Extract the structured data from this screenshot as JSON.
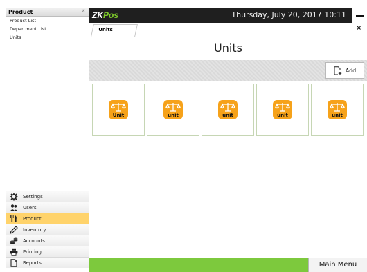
{
  "sidebar": {
    "header": "Product",
    "collapse_glyph": "«",
    "sub_items": [
      "Product List",
      "Department List",
      "Units"
    ],
    "nav_items": [
      {
        "label": "Settings",
        "icon": "gear-icon"
      },
      {
        "label": "Users",
        "icon": "users-icon"
      },
      {
        "label": "Product",
        "icon": "fork-knife-icon",
        "active": true
      },
      {
        "label": "Inventory",
        "icon": "pencil-icon"
      },
      {
        "label": "Accounts",
        "icon": "coins-icon"
      },
      {
        "label": "Printing",
        "icon": "printer-icon"
      },
      {
        "label": "Reports",
        "icon": "document-icon"
      }
    ]
  },
  "topbar": {
    "logo_zk": "ZK",
    "logo_pos": "Pos",
    "datetime": "Thursday, July 20, 2017 10:11"
  },
  "tabs": {
    "active_label": "Units",
    "close_glyph": "×"
  },
  "main": {
    "title": "Units",
    "add_label": "Add",
    "units": [
      "Unit",
      "unit",
      "unit",
      "unit",
      "unit"
    ]
  },
  "footer": {
    "main_menu_label": "Main Menu"
  },
  "colors": {
    "accent_orange": "#f6a21a",
    "active_nav": "#ffd36b",
    "status_green": "#7dc93d",
    "logo_green": "#7ecb2a"
  }
}
